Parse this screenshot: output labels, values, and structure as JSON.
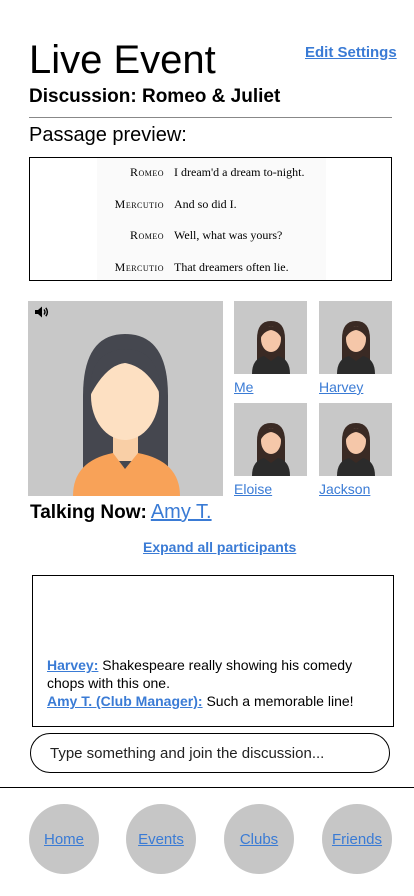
{
  "header": {
    "title": "Live Event",
    "edit_settings": "Edit Settings",
    "subtitle": "Discussion: Romeo & Juliet",
    "preview_label": "Passage preview:"
  },
  "passage": [
    {
      "speaker": "Romeo",
      "text": "I dream'd a dream to-night."
    },
    {
      "speaker": "Mercutio",
      "text": "And so did I."
    },
    {
      "speaker": "Romeo",
      "text": "Well, what was yours?"
    },
    {
      "speaker": "Mercutio",
      "text": "That dreamers often lie."
    }
  ],
  "video": {
    "speaker_icon": "speaker-volume-icon",
    "talking_label": "Talking Now:",
    "talking_name": "Amy T.",
    "participants": [
      "Me",
      "Harvey",
      "Eloise",
      "Jackson"
    ],
    "expand_label": "Expand all participants"
  },
  "chat": {
    "messages": [
      {
        "author": "Harvey:",
        "text": " Shakespeare really showing his comedy chops with this one."
      },
      {
        "author": "Amy T. (Club Manager):",
        "text": " Such a memorable line!"
      }
    ],
    "input_placeholder": "Type something and join the discussion..."
  },
  "nav": {
    "items": [
      "Home",
      "Events",
      "Clubs",
      "Friends"
    ]
  },
  "colors": {
    "link": "#3a7bd5",
    "tile_bg": "#c8c8c8",
    "nav_bg": "#c6c6c6"
  }
}
